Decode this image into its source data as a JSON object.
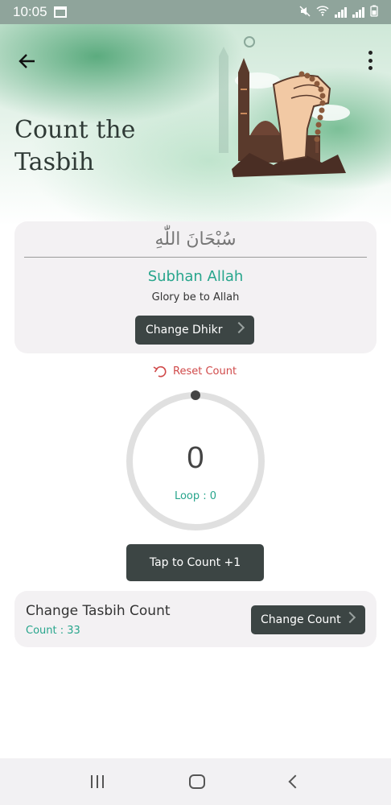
{
  "status_bar": {
    "time": "10:05"
  },
  "header": {
    "title_line1": "Count the",
    "title_line2": "Tasbih"
  },
  "dhikr": {
    "arabic": "سُبْحَانَ اللّٰهِ",
    "name": "Subhan Allah",
    "meaning": "Glory be to Allah",
    "change_label": "Change Dhikr"
  },
  "counter": {
    "reset_label": "Reset Count",
    "value": "0",
    "loop_label": "Loop : 0",
    "progress_fraction": 0,
    "tap_label": "Tap to Count +1"
  },
  "tasbih": {
    "title": "Change Tasbih Count",
    "count_label": "Count : 33",
    "change_count_label": "Change Count"
  },
  "colors": {
    "accent_green": "#27a58c",
    "button_dark": "#3c4544",
    "reset_red": "#d04a4a",
    "ring_gray": "#e0e0e0"
  },
  "icons": {
    "back": "arrow-left-icon",
    "menu": "more-vertical-icon",
    "reset": "undo-icon",
    "chevron": "chevron-right-icon",
    "nav_recents": "recents-icon",
    "nav_home": "home-icon",
    "nav_back": "nav-back-icon"
  }
}
